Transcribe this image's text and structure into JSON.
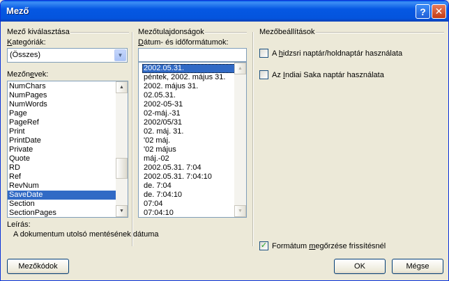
{
  "window": {
    "title": "Mező"
  },
  "titlebar": {
    "help_label": "?",
    "close_label": "✕"
  },
  "left": {
    "group_title": "Mező kiválasztása",
    "categories_label_u": "K",
    "categories_label_rest": "ategóriák:",
    "category_value": "(Összes)",
    "fieldnames_label_pre": "Mezőn",
    "fieldnames_label_u": "e",
    "fieldnames_label_post": "vek:",
    "fields": [
      "NumChars",
      "NumPages",
      "NumWords",
      "Page",
      "PageRef",
      "Print",
      "PrintDate",
      "Private",
      "Quote",
      "RD",
      "Ref",
      "RevNum",
      "SaveDate",
      "Section",
      "SectionPages"
    ],
    "selected_field": "SaveDate"
  },
  "middle": {
    "group_title": "Mezőtulajdonságok",
    "formats_label_u": "D",
    "formats_label_rest": "átum- és időformátumok:",
    "format_input_value": "",
    "formats": [
      "2002.05.31.",
      "péntek, 2002. május 31.",
      "2002. május 31.",
      "02.05.31.",
      "2002-05-31",
      "02-máj.-31",
      "2002/05/31",
      "02. máj. 31.",
      "'02 máj.",
      "'02 május",
      "máj.-02",
      "2002.05.31. 7:04",
      "2002.05.31. 7:04:10",
      "de. 7:04",
      "de. 7:04:10",
      "07:04",
      "07:04:10"
    ],
    "selected_format": "2002.05.31."
  },
  "right": {
    "group_title": "Mezőbeállítások",
    "hijri_pre": "A ",
    "hijri_u": "h",
    "hijri_post": "idzsri naptár/holdnaptár használata",
    "hijri_checked": false,
    "saka_pre": "Az ",
    "saka_u": "I",
    "saka_post": "ndiai Saka naptár használata",
    "saka_checked": false,
    "preserve_pre": "Formátum ",
    "preserve_u": "m",
    "preserve_post": "egőrzése frissítésnél",
    "preserve_checked": true
  },
  "description": {
    "label": "Leírás:",
    "text": "A dokumentum utolsó mentésének dátuma"
  },
  "buttons": {
    "fieldcodes": "Mezőkódok",
    "ok": "OK",
    "cancel": "Mégse"
  },
  "colors": {
    "selection": "#316ac5",
    "titlebar": "#0558e3",
    "face": "#ece9d8"
  }
}
